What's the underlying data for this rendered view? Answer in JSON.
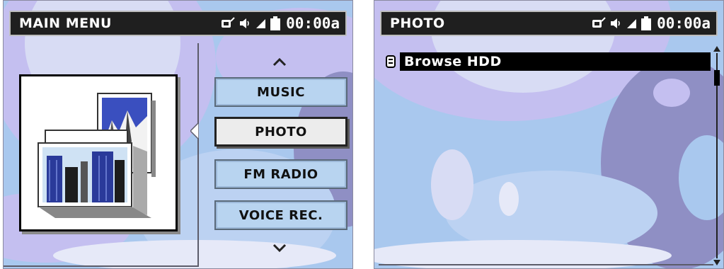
{
  "main_menu": {
    "title": "MAIN MENU",
    "clock": "00:00a",
    "menu_up_arrow": "^",
    "menu_down_arrow": "v",
    "items": [
      {
        "label": "MUSIC",
        "selected": false
      },
      {
        "label": "PHOTO",
        "selected": true
      },
      {
        "label": "FM RADIO",
        "selected": false
      },
      {
        "label": "VOICE REC.",
        "selected": false
      }
    ],
    "preview_icon": "photo-stack-icon"
  },
  "photo_screen": {
    "title": "PHOTO",
    "clock": "00:00a",
    "items": [
      {
        "label": "Browse HDD",
        "icon": "hdd-icon",
        "selected": true
      }
    ]
  },
  "status_icons": [
    "usb-connection-icon",
    "volume-icon",
    "signal-icon",
    "battery-icon"
  ],
  "colors": {
    "titlebar_bg": "#1f1f1f",
    "menu_item_bg": "#b8d4f0",
    "menu_selected_bg": "#ececec",
    "bg_light_blue": "#a9c8ee",
    "bg_lavender": "#c4bff0",
    "bg_purple": "#8f8fc4"
  }
}
